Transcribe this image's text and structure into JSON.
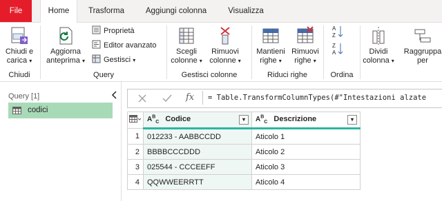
{
  "tabs": [
    "File",
    "Home",
    "Trasforma",
    "Aggiungi colonna",
    "Visualizza"
  ],
  "ribbon": {
    "chiudi": {
      "label1": "Chiudi e",
      "label2": "carica",
      "group": "Chiudi"
    },
    "aggiorna": {
      "label1": "Aggiorna",
      "label2": "anteprima"
    },
    "proprieta": "Proprietà",
    "editor": "Editor avanzato",
    "gestisci": "Gestisci",
    "query_group": "Query",
    "scegli": {
      "label1": "Scegli",
      "label2": "colonne"
    },
    "rimuovi_col": {
      "label1": "Rimuovi",
      "label2": "colonne"
    },
    "gestisci_col_group": "Gestisci colonne",
    "mantieni": {
      "label1": "Mantieni",
      "label2": "righe"
    },
    "rimuovi_righe": {
      "label1": "Rimuovi",
      "label2": "righe"
    },
    "riduci_group": "Riduci righe",
    "ordina_group": "Ordina",
    "dividi": {
      "label1": "Dividi",
      "label2": "colonna"
    },
    "raggruppa": {
      "label1": "Raggruppa",
      "label2": "per"
    }
  },
  "left_pane": {
    "title": "Query [1]",
    "query_name": "codici",
    "collapse_icon": "chevron-left-icon"
  },
  "formula": {
    "text": "= Table.TransformColumnTypes(#\"Intestazioni alzate"
  },
  "table": {
    "type_prefix": "A",
    "type_suffix": "B",
    "type_sub": "C",
    "headers": [
      "Codice",
      "Descrizione"
    ],
    "rows": [
      {
        "n": "1",
        "codice": "012233 - AABBCCDD",
        "descrizione": "Aticolo 1"
      },
      {
        "n": "2",
        "codice": "BBBBCCCDDD",
        "descrizione": "Aticolo 2"
      },
      {
        "n": "3",
        "codice": "025544 - CCCEEFF",
        "descrizione": "Aticolo 3"
      },
      {
        "n": "4",
        "codice": "QQWWEERRTT",
        "descrizione": "Aticolo 4"
      }
    ]
  },
  "colors": {
    "file_tab": "#e51d2a",
    "selected_query": "#a9dab8",
    "accent": "#2bb5a0"
  }
}
